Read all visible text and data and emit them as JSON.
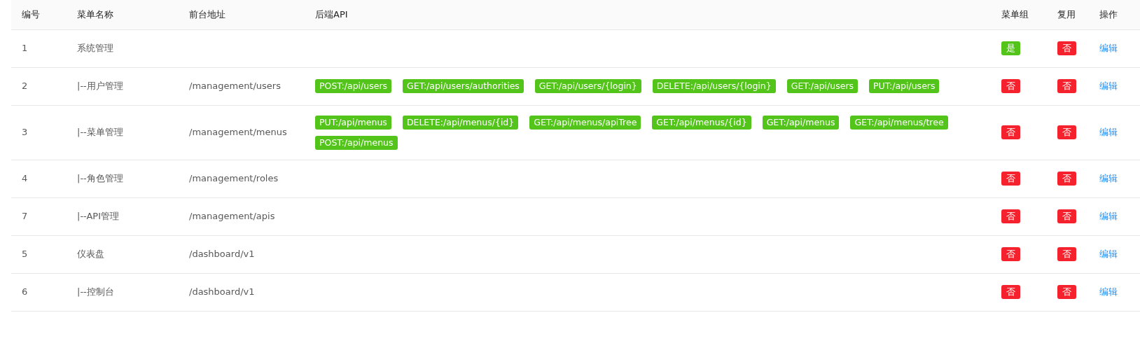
{
  "table": {
    "columns": [
      "编号",
      "菜单名称",
      "前台地址",
      "后端API",
      "菜单组",
      "复用",
      "操作"
    ],
    "rows": [
      {
        "id": "1",
        "name": "系统管理",
        "path": "",
        "apis": [],
        "group": {
          "text": "是",
          "on": true
        },
        "reuse": {
          "text": "否",
          "on": false
        },
        "action": "编辑"
      },
      {
        "id": "2",
        "name": "|--用户管理",
        "path": "/management/users",
        "apis": [
          "POST:/api/users",
          "GET:/api/users/authorities",
          "GET:/api/users/{login}",
          "DELETE:/api/users/{login}",
          "GET:/api/users",
          "PUT:/api/users"
        ],
        "group": {
          "text": "否",
          "on": false
        },
        "reuse": {
          "text": "否",
          "on": false
        },
        "action": "编辑"
      },
      {
        "id": "3",
        "name": "|--菜单管理",
        "path": "/management/menus",
        "apis": [
          "PUT:/api/menus",
          "DELETE:/api/menus/{id}",
          "GET:/api/menus/apiTree",
          "GET:/api/menus/{id}",
          "GET:/api/menus",
          "GET:/api/menus/tree",
          "POST:/api/menus"
        ],
        "group": {
          "text": "否",
          "on": false
        },
        "reuse": {
          "text": "否",
          "on": false
        },
        "action": "编辑"
      },
      {
        "id": "4",
        "name": "|--角色管理",
        "path": "/management/roles",
        "apis": [],
        "group": {
          "text": "否",
          "on": false
        },
        "reuse": {
          "text": "否",
          "on": false
        },
        "action": "编辑"
      },
      {
        "id": "7",
        "name": "|--API管理",
        "path": "/management/apis",
        "apis": [],
        "group": {
          "text": "否",
          "on": false
        },
        "reuse": {
          "text": "否",
          "on": false
        },
        "action": "编辑"
      },
      {
        "id": "5",
        "name": "仪表盘",
        "path": "/dashboard/v1",
        "apis": [],
        "group": {
          "text": "否",
          "on": false
        },
        "reuse": {
          "text": "否",
          "on": false
        },
        "action": "编辑"
      },
      {
        "id": "6",
        "name": "|--控制台",
        "path": "/dashboard/v1",
        "apis": [],
        "group": {
          "text": "否",
          "on": false
        },
        "reuse": {
          "text": "否",
          "on": false
        },
        "action": "编辑"
      }
    ]
  }
}
